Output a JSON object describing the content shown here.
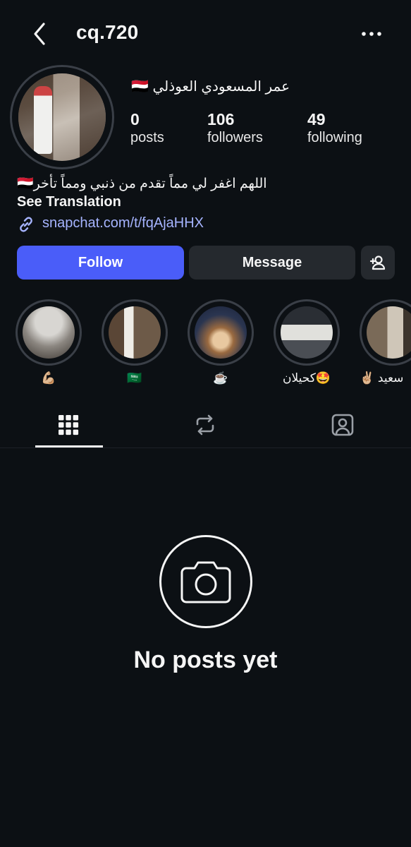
{
  "header": {
    "username": "cq.720"
  },
  "profile": {
    "display_name": "عمر المسعودي العوذلي 🇾🇪",
    "stats": {
      "posts_count": "0",
      "posts_label": "posts",
      "followers_count": "106",
      "followers_label": "followers",
      "following_count": "49",
      "following_label": "following"
    },
    "bio": "اللهم اغفر لي مماً تقدم من ذنبي ومماً تأخر🇾🇪",
    "see_translation": "See Translation",
    "link": "snapchat.com/t/fqAjaHHX"
  },
  "actions": {
    "follow_label": "Follow",
    "message_label": "Message"
  },
  "highlights": [
    {
      "label": "💪🏼"
    },
    {
      "label": "🇸🇦"
    },
    {
      "label": "☕️"
    },
    {
      "label": "كحيلان🤩"
    },
    {
      "label": "سعيد ✌🏼"
    }
  ],
  "empty_state": {
    "title": "No posts yet"
  },
  "colors": {
    "background": "#0c1014",
    "follow_button": "#4a5df9",
    "secondary_button": "#25292e",
    "link": "#a6b4ff"
  }
}
